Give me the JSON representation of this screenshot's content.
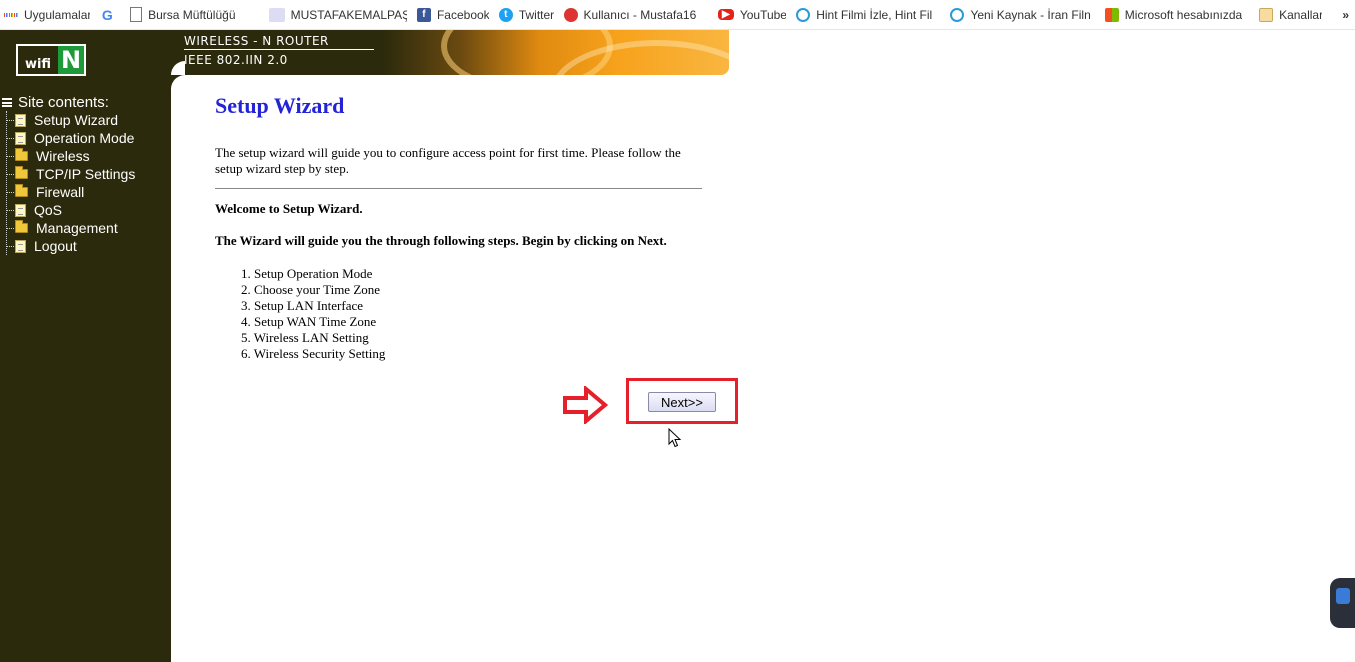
{
  "bookmarks": [
    {
      "label": "Uygulamalar",
      "icon": "apps-grid-icon"
    },
    {
      "label": "",
      "icon": "google-icon"
    },
    {
      "label": "Bursa Müftülüğü",
      "icon": "page-icon"
    },
    {
      "label": "MUSTAFAKEMALPAŞA",
      "icon": "page-icon"
    },
    {
      "label": "Facebook",
      "icon": "facebook-icon"
    },
    {
      "label": "Twitter",
      "icon": "twitter-icon"
    },
    {
      "label": "Kullanıcı - Mustafa16",
      "icon": "page-icon"
    },
    {
      "label": "YouTube",
      "icon": "youtube-icon"
    },
    {
      "label": "Hint Filmi İzle, Hint Fil",
      "icon": "globe-icon"
    },
    {
      "label": "Yeni Kaynak - İran Filn",
      "icon": "globe-icon"
    },
    {
      "label": "Microsoft hesabınızda",
      "icon": "microsoft-icon"
    },
    {
      "label": "Kanallar",
      "icon": "folder-icon"
    }
  ],
  "bookmarks_overflow": "»",
  "logo": {
    "wifi": "wifi",
    "n": "N"
  },
  "banner": {
    "line1": "WIRELESS - N ROUTER",
    "line2": "IEEE 802.IIN 2.0"
  },
  "sidebar": {
    "title": "Site contents:",
    "items": [
      {
        "label": "Setup Wizard",
        "type": "doc"
      },
      {
        "label": "Operation Mode",
        "type": "doc"
      },
      {
        "label": "Wireless",
        "type": "folder"
      },
      {
        "label": "TCP/IP Settings",
        "type": "folder"
      },
      {
        "label": "Firewall",
        "type": "folder"
      },
      {
        "label": "QoS",
        "type": "doc"
      },
      {
        "label": "Management",
        "type": "folder"
      },
      {
        "label": "Logout",
        "type": "doc"
      }
    ]
  },
  "main": {
    "title": "Setup Wizard",
    "intro": "The setup wizard will guide you to configure access point for first time. Please follow the setup wizard step by step.",
    "welcome": "Welcome to Setup Wizard.",
    "guide": "The Wizard will guide you the through following steps. Begin by clicking on Next.",
    "steps": [
      "1. Setup Operation Mode",
      "2. Choose your Time Zone",
      "3. Setup LAN Interface",
      "4. Setup WAN Time Zone",
      "5. Wireless LAN Setting",
      "6. Wireless Security Setting"
    ],
    "next_label": "Next>>"
  },
  "colors": {
    "sidebar_bg": "#2b2a0c",
    "title_blue": "#2424d6",
    "annotation_red": "#e5202a"
  }
}
